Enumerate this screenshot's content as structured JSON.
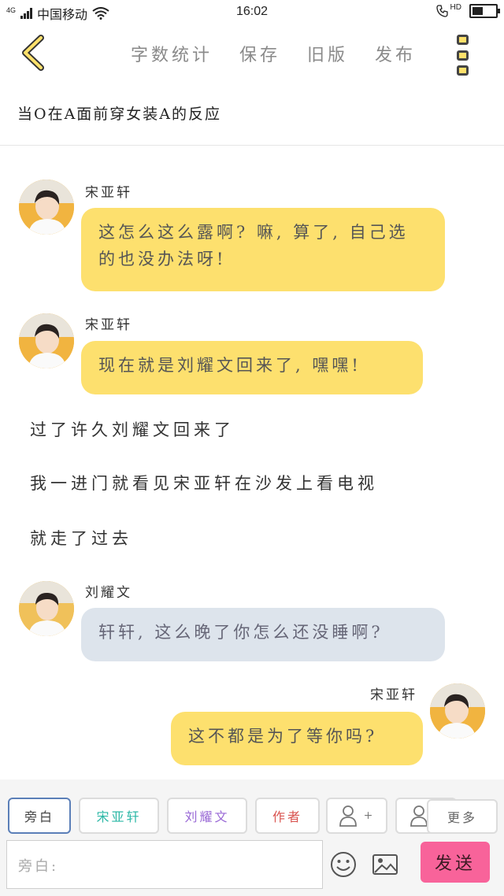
{
  "status": {
    "network": "4G",
    "carrier": "中国移动",
    "time": "16:02",
    "hd": "HD",
    "battery_level": 0.45
  },
  "header": {
    "back_icon": "chevron-left-icon",
    "items": [
      "字数统计",
      "保存",
      "旧版",
      "发布"
    ],
    "menu_icon": "more-vertical-icon"
  },
  "story_title": "当O在A面前穿女装A的反应",
  "messages": [
    {
      "type": "left",
      "name": "宋亚轩",
      "text": "这怎么这么露啊? 嘛, 算了, 自己选的也没办法呀!"
    },
    {
      "type": "left",
      "name": "宋亚轩",
      "text": "现在就是刘耀文回来了, 嘿嘿!"
    },
    {
      "type": "narration",
      "text": "过了许久刘耀文回来了"
    },
    {
      "type": "narration",
      "text": "我一进门就看见宋亚轩在沙发上看电视"
    },
    {
      "type": "narration",
      "text": "就走了过去"
    },
    {
      "type": "left-gray",
      "name": "刘耀文",
      "text": "轩轩, 这么晚了你怎么还没睡啊?"
    },
    {
      "type": "right",
      "name": "宋亚轩",
      "text": "这不都是为了等你吗?"
    }
  ],
  "roles": [
    {
      "label": "旁白",
      "color": "#444444"
    },
    {
      "label": "宋亚轩",
      "color": "#2bb7a6"
    },
    {
      "label": "刘耀文",
      "color": "#9a6ad6"
    },
    {
      "label": "作者",
      "color": "#d9534f"
    },
    {
      "label": "+",
      "color": "#777777"
    },
    {
      "label": "",
      "color": "#777777"
    },
    {
      "label": "更多",
      "color": "#666666"
    }
  ],
  "input": {
    "placeholder": "旁白:"
  },
  "send_label": "发送",
  "colors": {
    "accent_yellow": "#fde06e",
    "send_pink": "#f8639a",
    "bubble_gray": "#dde4ec"
  }
}
